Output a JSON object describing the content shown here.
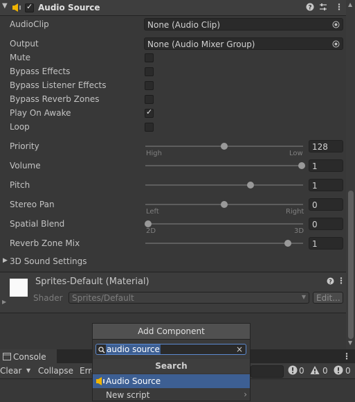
{
  "component": {
    "title": "Audio Source"
  },
  "fields": {
    "audioclip": {
      "label": "AudioClip",
      "value": "None (Audio Clip)"
    },
    "output": {
      "label": "Output",
      "value": "None (Audio Mixer Group)"
    }
  },
  "toggles": [
    {
      "label": "Mute",
      "checked": false
    },
    {
      "label": "Bypass Effects",
      "checked": false
    },
    {
      "label": "Bypass Listener Effects",
      "checked": false
    },
    {
      "label": "Bypass Reverb Zones",
      "checked": false
    },
    {
      "label": "Play On Awake",
      "checked": true
    },
    {
      "label": "Loop",
      "checked": false
    }
  ],
  "sliders": [
    {
      "label": "Priority",
      "value": "128",
      "level": 0.5,
      "min_label": "High",
      "max_label": "Low"
    },
    {
      "label": "Volume",
      "value": "1",
      "level": 1.0
    },
    {
      "label": "Pitch",
      "value": "1",
      "level": 0.667
    },
    {
      "label": "Stereo Pan",
      "value": "0",
      "level": 0.5,
      "min_label": "Left",
      "max_label": "Right"
    },
    {
      "label": "Spatial Blend",
      "value": "0",
      "level": 0.0,
      "min_label": "2D",
      "max_label": "3D"
    },
    {
      "label": "Reverb Zone Mix",
      "value": "1",
      "level": 0.909
    }
  ],
  "sound_settings": {
    "label": "3D Sound Settings"
  },
  "material": {
    "title": "Sprites-Default (Material)",
    "shader_label": "Shader",
    "shader_value": "Sprites/Default",
    "edit_label": "Edit..."
  },
  "add_component": {
    "button_label": "Add Component",
    "search_value": "audio source",
    "section_title": "Search",
    "results": [
      "Audio Source",
      "New script"
    ]
  },
  "console": {
    "tab_label": "Console",
    "clear_label": "Clear",
    "collapse_label": "Collapse",
    "error_label": "Erro",
    "counts": [
      "0",
      "0",
      "0"
    ]
  },
  "colors": {
    "accent": "#3d5f93",
    "speaker": "#f0b400",
    "background": "#383838"
  }
}
